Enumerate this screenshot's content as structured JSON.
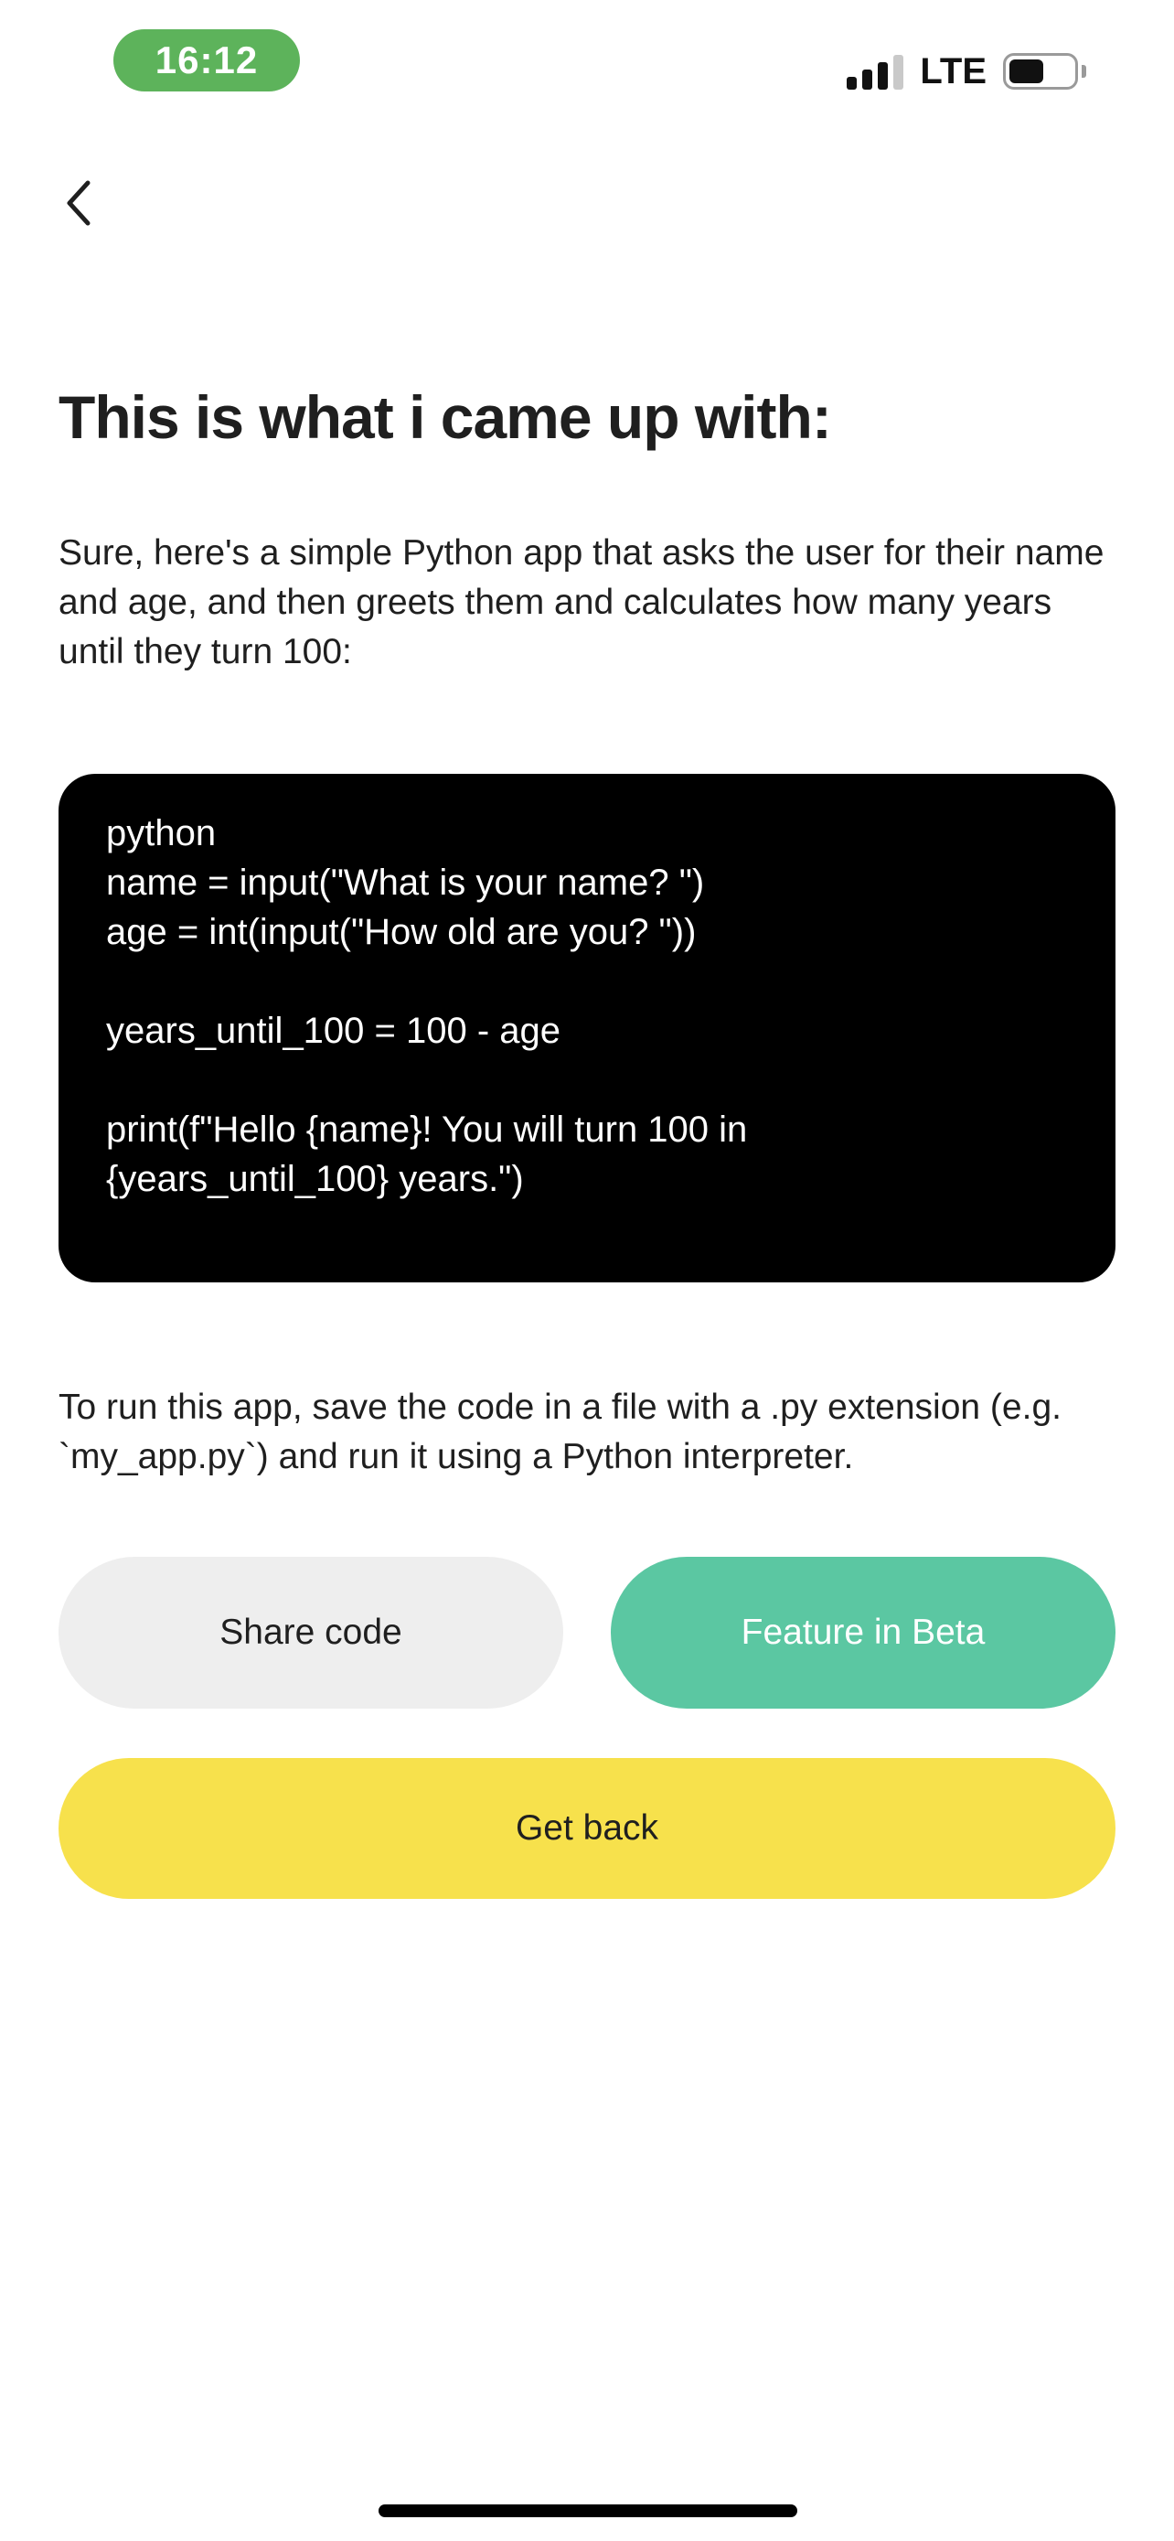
{
  "status_bar": {
    "time": "16:12",
    "network": "LTE",
    "signal_bars_active": 3,
    "signal_bars_total": 4,
    "battery_level": 0.55
  },
  "header": {
    "back_icon": "chevron-left-icon"
  },
  "main": {
    "title": "This is what i came up with:",
    "intro": "Sure, here's a simple Python app that asks the user for their name and age, and then greets them and calculates how many years until they turn 100:",
    "code_lines": [
      "python",
      "name = input(\"What is your name? \")",
      "age = int(input(\"How old are you? \"))",
      "",
      "years_until_100 = 100 - age",
      "",
      "print(f\"Hello {name}! You will turn 100 in",
      "{years_until_100} years.\")"
    ],
    "instructions": "To run this app, save the code in a file with a .py extension (e.g. `my_app.py`) and run it using a Python interpreter."
  },
  "actions": {
    "share_label": "Share code",
    "beta_label": "Feature in Beta",
    "back_label": "Get back"
  },
  "colors": {
    "time_pill": "#5db35b",
    "code_background": "#000000",
    "share_button": "#eeeeee",
    "beta_button": "#5bc7a2",
    "back_button": "#f7e14c"
  }
}
